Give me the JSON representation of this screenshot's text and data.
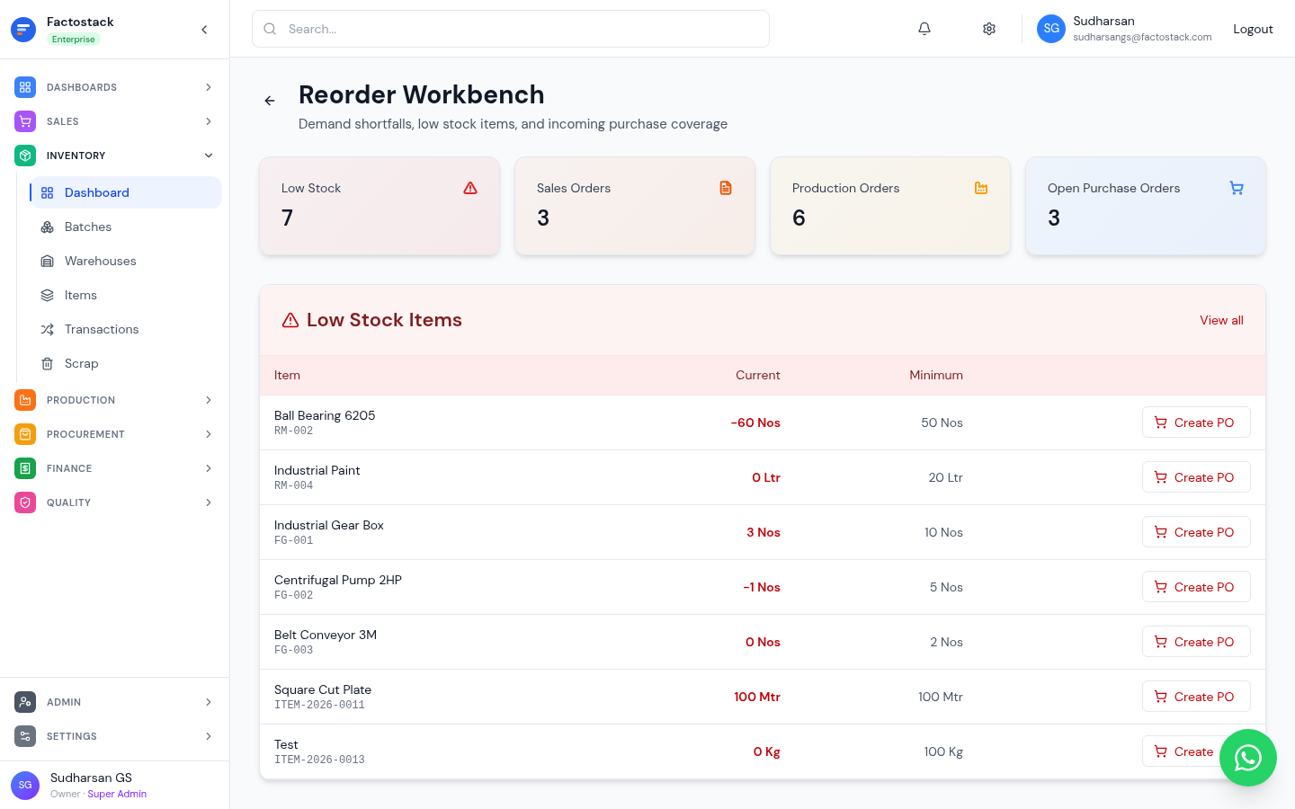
{
  "brand": {
    "name": "Factostack",
    "plan": "Enterprise"
  },
  "nav": [
    {
      "label": "DASHBOARDS",
      "color": "#3b82f6",
      "expanded": false
    },
    {
      "label": "SALES",
      "color": "#a855f7",
      "expanded": false
    },
    {
      "label": "INVENTORY",
      "color": "#10b981",
      "expanded": true,
      "children": [
        {
          "label": "Dashboard",
          "selected": true
        },
        {
          "label": "Batches",
          "selected": false
        },
        {
          "label": "Warehouses",
          "selected": false
        },
        {
          "label": "Items",
          "selected": false
        },
        {
          "label": "Transactions",
          "selected": false
        },
        {
          "label": "Scrap",
          "selected": false
        }
      ]
    },
    {
      "label": "PRODUCTION",
      "color": "#f97316",
      "expanded": false
    },
    {
      "label": "PROCUREMENT",
      "color": "#f59e0b",
      "expanded": false
    },
    {
      "label": "FINANCE",
      "color": "#16a34a",
      "expanded": false
    },
    {
      "label": "QUALITY",
      "color": "#ec4899",
      "expanded": false
    }
  ],
  "nav_bottom": [
    {
      "label": "ADMIN",
      "color": "#4b5563",
      "expanded": false
    },
    {
      "label": "SETTINGS",
      "color": "#6b7280",
      "expanded": false
    }
  ],
  "sidebar_user": {
    "initials": "SG",
    "name": "Sudharsan GS",
    "role": "Owner",
    "separator": "·",
    "title": "Super Admin"
  },
  "search": {
    "placeholder": "Search..."
  },
  "header_user": {
    "initials": "SG",
    "name": "Sudharsan",
    "email": "sudharsangs@factostack.com",
    "logout": "Logout"
  },
  "page": {
    "title": "Reorder Workbench",
    "subtitle": "Demand shortfalls, low stock items, and incoming purchase coverage"
  },
  "stats": [
    {
      "label": "Low Stock",
      "value": "7",
      "color": "#dc2626"
    },
    {
      "label": "Sales Orders",
      "value": "3",
      "color": "#ea580c"
    },
    {
      "label": "Production Orders",
      "value": "6",
      "color": "#f59e0b"
    },
    {
      "label": "Open Purchase Orders",
      "value": "3",
      "color": "#3b82f6"
    }
  ],
  "low_stock": {
    "title": "Low Stock Items",
    "view_all": "View all",
    "columns": [
      "Item",
      "Current",
      "Minimum"
    ],
    "rows": [
      {
        "item": "Ball Bearing 6205",
        "code": "RM-002",
        "current": "-60 Nos",
        "minimum": "50 Nos",
        "action": "Create PO"
      },
      {
        "item": "Industrial Paint",
        "code": "RM-004",
        "current": "0 Ltr",
        "minimum": "20 Ltr",
        "action": "Create PO"
      },
      {
        "item": "Industrial Gear Box",
        "code": "FG-001",
        "current": "3 Nos",
        "minimum": "10 Nos",
        "action": "Create PO"
      },
      {
        "item": "Centrifugal Pump 2HP",
        "code": "FG-002",
        "current": "-1 Nos",
        "minimum": "5 Nos",
        "action": "Create PO"
      },
      {
        "item": "Belt Conveyor 3M",
        "code": "FG-003",
        "current": "0 Nos",
        "minimum": "2 Nos",
        "action": "Create PO"
      },
      {
        "item": "Square Cut Plate",
        "code": "ITEM-2026-0011",
        "current": "100 Mtr",
        "minimum": "100 Mtr",
        "action": "Create PO"
      },
      {
        "item": "Test",
        "code": "ITEM-2026-0013",
        "current": "0 Kg",
        "minimum": "100 Kg",
        "action": "Create"
      }
    ]
  }
}
